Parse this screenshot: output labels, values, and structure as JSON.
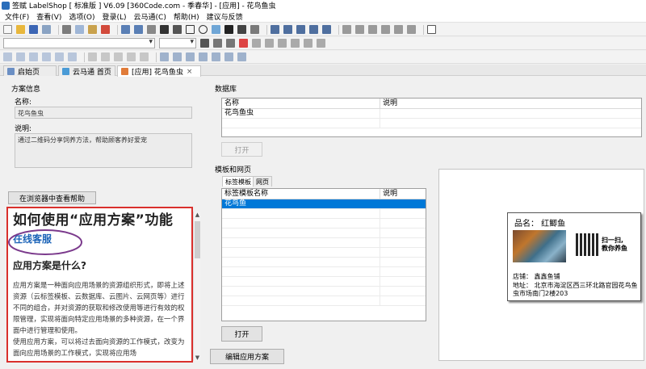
{
  "window": {
    "title": "签赋 LabelShop [ 标准版 ]  V6.09  [360Code.com - 季春华] - [应用] - 花鸟鱼虫"
  },
  "menu": [
    "文件(F)",
    "查看(V)",
    "选项(O)",
    "登录(L)",
    "云马通(C)",
    "帮助(H)",
    "建议与反馈"
  ],
  "tabs": [
    {
      "label": "启始页"
    },
    {
      "label": "云马通 首页"
    },
    {
      "label": "[应用] 花鸟鱼虫",
      "close": "×"
    }
  ],
  "plan": {
    "group_label": "方案信息",
    "name_label": "名称:",
    "name_value": "花鸟鱼虫",
    "desc_label": "说明:",
    "desc_value": "通过二维码分享饲养方法，帮助顾客养好爱宠",
    "browser_help_button": "在浏览器中查看帮助"
  },
  "help": {
    "title": "如何使用“应用方案”功能",
    "online_service": "在线客服",
    "subtitle": "应用方案是什么?",
    "para1": "应用方案是一种面向应用场景的资源组织形式，即将上述资源（云标签模板、云数据库、云图片、云网页等）进行不同的组合，并对资源的获取和修改使用等进行有效的权限管理，实现将面向特定应用场景的多种资源，在一个界面中进行管理和使用。",
    "para2": "使用应用方案，可以将过去面向资源的工作模式，改变为面向应用场景的工作模式，实现将应用场"
  },
  "database": {
    "group_label": "数据库",
    "columns": [
      "名称",
      "说明"
    ],
    "rows": [
      [
        "花鸟鱼虫",
        ""
      ]
    ],
    "open_button": "打开"
  },
  "templates": {
    "group_label": "模板和网页",
    "subtabs": [
      "标签模板",
      "网页"
    ],
    "columns": [
      "标签模板名称",
      "说明"
    ],
    "rows": [
      [
        "花鸟鱼",
        ""
      ]
    ],
    "open_button": "打开"
  },
  "edit_button": "编辑应用方案",
  "label_preview": {
    "product_name": "品名： 红鲫鱼",
    "qr_caption_1": "扫一扫,",
    "qr_caption_2": "教你养鱼",
    "store": "店铺： 鑫鑫鱼铺",
    "address": "地址： 北京市海淀区西三环北路官园花鸟鱼虫市场南门2楼203"
  },
  "colors": {
    "accent": "#0078d7",
    "help_border": "#d9302c",
    "link": "#1c64b8",
    "oval": "#7b3a8c"
  }
}
